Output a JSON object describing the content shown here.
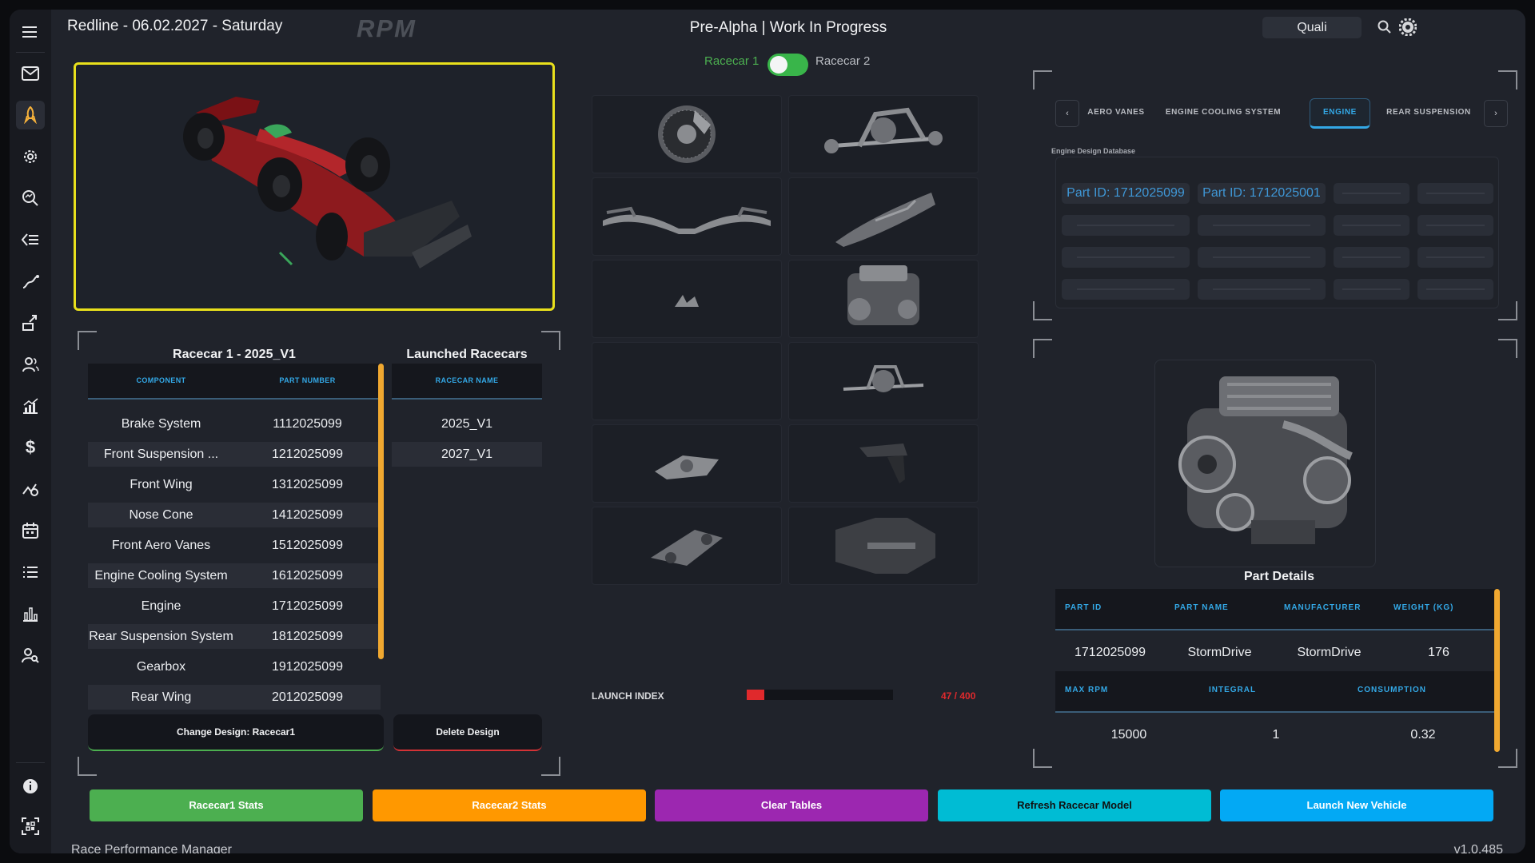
{
  "app": {
    "title": "Redline - 06.02.2027 - Saturday",
    "logo_text": "RPM",
    "status_title": "Pre-Alpha | Work In Progress",
    "mode_value": "Quali"
  },
  "sidebar": {
    "items": [
      {
        "icon": "menu-icon"
      },
      {
        "icon": "mail-icon"
      },
      {
        "icon": "rocket-icon",
        "active": true
      },
      {
        "icon": "gear-icon"
      },
      {
        "icon": "search-analytics-icon"
      },
      {
        "icon": "list-back-icon"
      },
      {
        "icon": "track-icon"
      },
      {
        "icon": "upgrade-icon"
      },
      {
        "icon": "users-icon"
      },
      {
        "icon": "chart-icon"
      },
      {
        "icon": "dollar-icon"
      },
      {
        "icon": "telemetry-icon"
      },
      {
        "icon": "calendar-icon"
      },
      {
        "icon": "list-icon"
      },
      {
        "icon": "bar-chart-icon"
      },
      {
        "icon": "user-search-icon"
      }
    ],
    "bottom": [
      {
        "icon": "info-icon"
      },
      {
        "icon": "scan-icon"
      }
    ]
  },
  "toggle": {
    "left_label": "Racecar 1",
    "right_label": "Racecar 2",
    "state": "on"
  },
  "design_table": {
    "title": "Racecar 1 - 2025_V1",
    "headers": [
      "COMPONENT",
      "PART NUMBER"
    ],
    "rows": [
      [
        "Brake System",
        "1112025099"
      ],
      [
        "Front Suspension ...",
        "1212025099"
      ],
      [
        "Front Wing",
        "1312025099"
      ],
      [
        "Nose Cone",
        "1412025099"
      ],
      [
        "Front Aero Vanes",
        "1512025099"
      ],
      [
        "Engine Cooling System",
        "1612025099"
      ],
      [
        "Engine",
        "1712025099"
      ],
      [
        "Rear Suspension System",
        "1812025099"
      ],
      [
        "Gearbox",
        "1912025099"
      ],
      [
        "Rear Wing",
        "2012025099"
      ]
    ]
  },
  "launched_table": {
    "title": "Launched Racecars",
    "header": "RACECAR NAME",
    "rows": [
      "2025_V1",
      "2027_V1"
    ]
  },
  "buttons": {
    "change_design": "Change Design: Racecar1",
    "delete_design": "Delete Design",
    "racecar1_stats": "Racecar1 Stats",
    "racecar2_stats": "Racecar2 Stats",
    "clear_tables": "Clear Tables",
    "refresh_model": "Refresh Racecar Model",
    "launch_vehicle": "Launch New Vehicle"
  },
  "launch": {
    "label": "LAUNCH INDEX",
    "value": 47,
    "max": 400,
    "text": "47 / 400"
  },
  "tabs": {
    "items": [
      "AERO VANES",
      "ENGINE COOLING SYSTEM",
      "ENGINE",
      "REAR SUSPENSION"
    ],
    "active": "ENGINE"
  },
  "engine_db": {
    "title": "Engine Design Database",
    "parts": [
      "Part ID: 1712025099",
      "Part ID: 1712025001"
    ]
  },
  "part_details": {
    "title": "Part Details",
    "headers1": [
      "PART ID",
      "PART NAME",
      "MANUFACTURER",
      "WEIGHT (KG)"
    ],
    "values1": [
      "1712025099",
      "StormDrive",
      "StormDrive",
      "176"
    ],
    "headers2": [
      "MAX RPM",
      "INTEGRAL",
      "CONSUMPTION"
    ],
    "values2": [
      "15000",
      "1",
      "0.32"
    ]
  },
  "footer": {
    "left": "Race Performance Manager",
    "right": "v1.0.485"
  },
  "colors": {
    "accent_blue": "#33a8e6",
    "accent_orange": "#f0a830",
    "highlight_yellow": "#e9e01c",
    "green": "#4caf50",
    "orange": "#ff9800",
    "purple": "#9c27b0",
    "teal": "#00bcd4",
    "blue": "#03a9f4"
  }
}
